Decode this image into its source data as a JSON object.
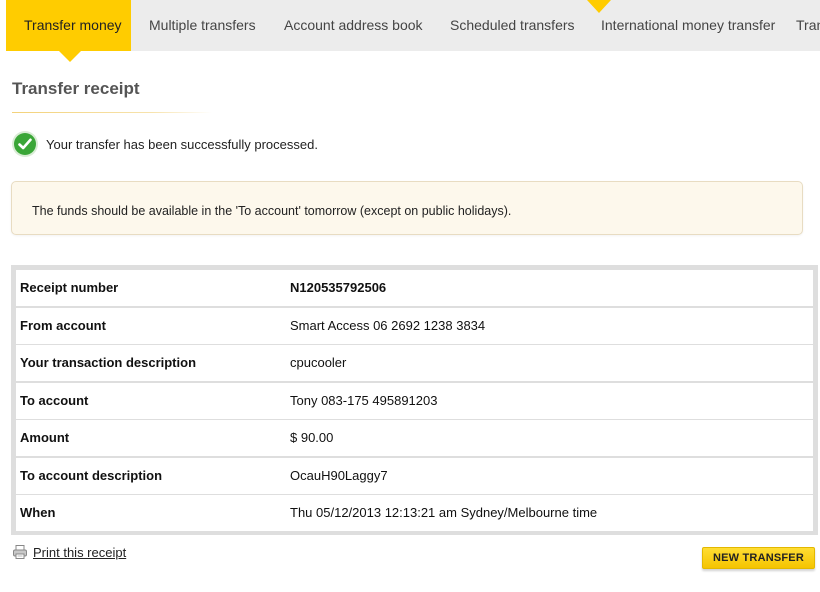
{
  "tabs": [
    {
      "label": "Transfer money",
      "active": true
    },
    {
      "label": "Multiple transfers"
    },
    {
      "label": "Account address book"
    },
    {
      "label": "Scheduled transfers"
    },
    {
      "label": "International money transfer"
    },
    {
      "label": "Tran"
    }
  ],
  "page": {
    "title": "Transfer receipt",
    "success_message": "Your transfer has been successfully processed.",
    "info_message": "The funds should be available in the 'To account' tomorrow (except on public holidays)."
  },
  "receipt": {
    "rows": [
      {
        "label": "Receipt number",
        "value": "N120535792506"
      },
      {
        "label": "From account",
        "value": "Smart Access 06 2692 1238 3834"
      },
      {
        "label": "Your transaction description",
        "value": "cpucooler"
      },
      {
        "label": "To account",
        "value": "Tony 083-175 495891203"
      },
      {
        "label": "Amount",
        "value": "$ 90.00"
      },
      {
        "label": "To account description",
        "value": "OcauH90Laggy7"
      },
      {
        "label": "When",
        "value": "Thu 05/12/2013 12:13:21 am Sydney/Melbourne time"
      }
    ]
  },
  "footer": {
    "print_label": "Print this receipt",
    "new_transfer_label": "NEW TRANSFER"
  },
  "colors": {
    "accent": "#ffcc00",
    "success": "#3aa637",
    "info_bg": "#fdf8ec"
  },
  "icons": {
    "success": "check-circle-icon",
    "print": "printer-icon"
  }
}
